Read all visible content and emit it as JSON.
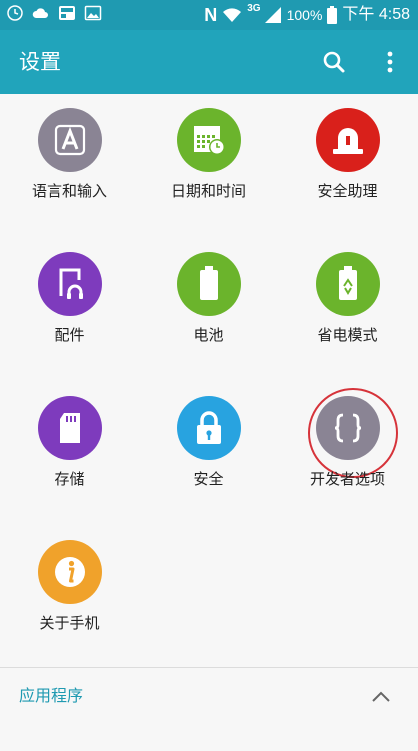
{
  "statusbar": {
    "icons": [
      "alarm-icon",
      "cloud-icon",
      "news-icon",
      "gallery-icon",
      "nfc-icon",
      "wifi-icon",
      "signal-icon",
      "battery-icon"
    ],
    "nfc": "N",
    "network": "3G",
    "battery": "100%",
    "time": "下午 4:58"
  },
  "toolbar": {
    "title": "设置",
    "icons": [
      "search-icon",
      "more-vert-icon"
    ]
  },
  "tiles": [
    {
      "label": "语言和输入",
      "icon": "language-icon",
      "color": "#8a8494"
    },
    {
      "label": "日期和时间",
      "icon": "calendar-clock-icon",
      "color": "#6bb42c"
    },
    {
      "label": "安全助理",
      "icon": "alarm-light-icon",
      "color": "#d9201b"
    },
    {
      "label": "配件",
      "icon": "accessory-icon",
      "color": "#7e3bbd"
    },
    {
      "label": "电池",
      "icon": "battery-icon",
      "color": "#6bb42c"
    },
    {
      "label": "省电模式",
      "icon": "power-saving-icon",
      "color": "#6bb42c"
    },
    {
      "label": "存储",
      "icon": "sd-card-icon",
      "color": "#7e3bbd"
    },
    {
      "label": "安全",
      "icon": "lock-icon",
      "color": "#28a3e0"
    },
    {
      "label": "开发者选项",
      "icon": "developer-braces-icon",
      "color": "#8a8494"
    },
    {
      "label": "关于手机",
      "icon": "info-icon",
      "color": "#f0a22b"
    }
  ],
  "highlight": {
    "tile": "开发者选项",
    "color": "#d6333a"
  },
  "section": {
    "label": "应用程序",
    "icon": "chevron-up-icon"
  },
  "colors": {
    "statusbar": "#1f9ab1",
    "toolbar": "#21a4bb",
    "background": "#f7f7f7"
  }
}
